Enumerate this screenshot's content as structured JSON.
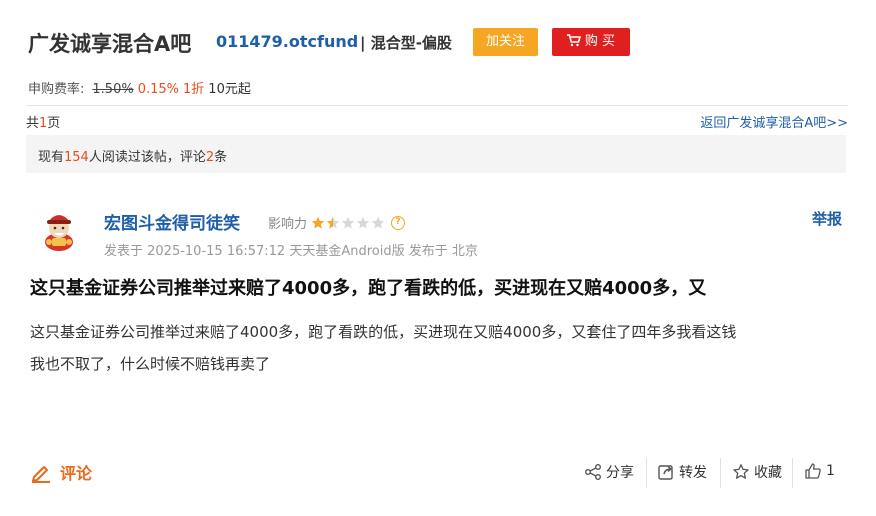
{
  "header": {
    "title": "广发诚享混合A吧",
    "fund_code": "011479.otcfund",
    "fund_type": "| 混合型-偏股",
    "follow_label": "加关注",
    "buy_label": "购 买"
  },
  "fee": {
    "label": "申购费率:",
    "original": "1.50%",
    "current": "0.15%",
    "discount": "1折",
    "minimum": "10元起"
  },
  "pagination": {
    "prefix": "共",
    "count": "1",
    "suffix": "页",
    "back_link": "返回广发诚享混合A吧>>"
  },
  "stats": {
    "prefix": "现有",
    "readers": "154",
    "middle": "人阅读过该帖，评论",
    "comments": "2",
    "suffix": "条"
  },
  "post": {
    "author": "宏图斗金得司徒笑",
    "influence_label": "影响力",
    "influence_rating": 1.5,
    "influence_max": 5,
    "report_label": "举报",
    "meta": "发表于 2025-10-15 16:57:12 天天基金Android版 发布于 北京",
    "title": "这只基金证券公司推举过来赔了4000多，跑了看跌的低，买进现在又赔4000多，又",
    "body_line1": "这只基金证券公司推举过来赔了4000多，跑了看跌的低，买进现在又赔4000多，又套住了四年多我看这钱",
    "body_line2": "我也不取了，什么时候不赔钱再卖了"
  },
  "actions": {
    "comment_label": "评论",
    "share_label": "分享",
    "forward_label": "转发",
    "collect_label": "收藏",
    "like_count": "1"
  },
  "colors": {
    "link_blue": "#1f5fa8",
    "accent_orange": "#e84d1a",
    "follow_orange": "#f5a623",
    "buy_red": "#e02020"
  }
}
